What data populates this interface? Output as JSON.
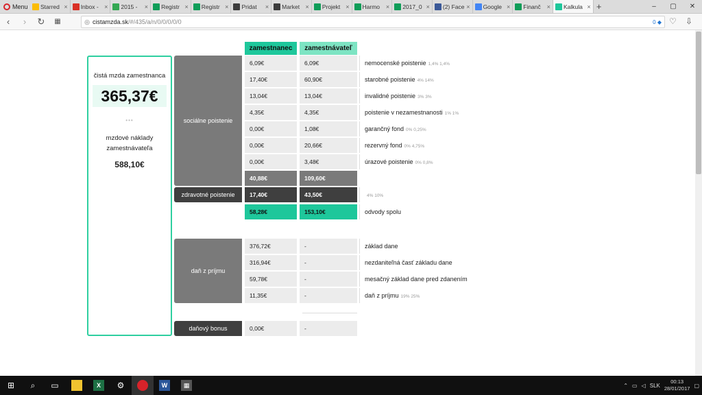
{
  "browser": {
    "menu_label": "Menu",
    "tabs": [
      {
        "label": "Starred",
        "icon": "drive-icon",
        "color": "#fbbc04"
      },
      {
        "label": "Inbox -",
        "icon": "gmail-icon",
        "color": "#d93025"
      },
      {
        "label": "2015 -",
        "icon": "drive-icon",
        "color": "#34a853"
      },
      {
        "label": "Registr",
        "icon": "sheets-icon",
        "color": "#0f9d58"
      },
      {
        "label": "Registr",
        "icon": "sheets-icon",
        "color": "#0f9d58"
      },
      {
        "label": "Pridat",
        "icon": "image-icon",
        "color": "#3b3b3b"
      },
      {
        "label": "Market",
        "icon": "image-icon",
        "color": "#3b3b3b"
      },
      {
        "label": "Projekt",
        "icon": "sheets-icon",
        "color": "#0f9d58"
      },
      {
        "label": "Harmo",
        "icon": "sheets-icon",
        "color": "#0f9d58"
      },
      {
        "label": "2017_0",
        "icon": "sheets-icon",
        "color": "#0f9d58"
      },
      {
        "label": "(2) Face",
        "icon": "facebook-icon",
        "color": "#3b5998"
      },
      {
        "label": "Google",
        "icon": "calendar-icon",
        "color": "#4285f4"
      },
      {
        "label": "Finanč",
        "icon": "sheets-icon",
        "color": "#0f9d58"
      },
      {
        "label": "Kalkula",
        "icon": "calc-logo-icon",
        "color": "#1ec79b"
      }
    ],
    "url_host": "cistamzda.sk",
    "url_path": "/#/435/a/n/0/0/0/0/0",
    "url_badge": "0"
  },
  "summary": {
    "net_title": "čistá mzda zamestnanca",
    "net_amount": "365,37€",
    "dots": "•••",
    "cost_title": "mzdové náklady zamestnávateľa",
    "cost_amount": "588,10€"
  },
  "columns": {
    "employee": "zamestnanec",
    "employer": "zamestnávateľ"
  },
  "groups": {
    "social": "sociálne poistenie",
    "health": "zdravotné poistenie",
    "tax": "daň z príjmu",
    "bonus": "daňový bonus"
  },
  "social_rows": [
    {
      "emp": "6,09€",
      "er": "6,09€",
      "desc": "nemocenské poistenie",
      "rate": "1,4% 1,4%"
    },
    {
      "emp": "17,40€",
      "er": "60,90€",
      "desc": "starobné poistenie",
      "rate": "4% 14%"
    },
    {
      "emp": "13,04€",
      "er": "13,04€",
      "desc": "invalidné poistenie",
      "rate": "3% 3%"
    },
    {
      "emp": "4,35€",
      "er": "4,35€",
      "desc": "poistenie v nezamestnanosti",
      "rate": "1% 1%"
    },
    {
      "emp": "0,00€",
      "er": "1,08€",
      "desc": "garančný fond",
      "rate": "0% 0,25%"
    },
    {
      "emp": "0,00€",
      "er": "20,66€",
      "desc": "rezervný fond",
      "rate": "0% 4,75%"
    },
    {
      "emp": "0,00€",
      "er": "3,48€",
      "desc": "úrazové poistenie",
      "rate": "0% 0,8%"
    }
  ],
  "social_total": {
    "emp": "40,88€",
    "er": "109,60€"
  },
  "health_row": {
    "emp": "17,40€",
    "er": "43,50€",
    "rate": "4% 10%"
  },
  "levy_total": {
    "emp": "58,28€",
    "er": "153,10€",
    "desc": "odvody spolu"
  },
  "tax_rows": [
    {
      "emp": "376,72€",
      "er": "-",
      "desc": "základ dane",
      "rate": ""
    },
    {
      "emp": "316,94€",
      "er": "-",
      "desc": "nezdaniteľná časť základu dane",
      "rate": ""
    },
    {
      "emp": "59,78€",
      "er": "-",
      "desc": "mesačný základ dane pred zdanením",
      "rate": ""
    },
    {
      "emp": "11,35€",
      "er": "-",
      "desc": "daň z príjmu",
      "rate": "19% 25%"
    }
  ],
  "bonus_row": {
    "emp": "0,00€",
    "er": "-"
  },
  "taskbar": {
    "tray_lang": "SLK",
    "time": "00:13",
    "date": "28/01/2017"
  }
}
